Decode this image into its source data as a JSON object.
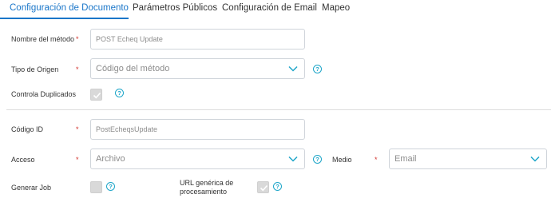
{
  "tabs": [
    {
      "label": "Configuración de Documento",
      "active": true
    },
    {
      "label": "Parámetros Públicos"
    },
    {
      "label": "Configuración de Email"
    },
    {
      "label": "Mapeo"
    }
  ],
  "form": {
    "nombre_metodo": {
      "label": "Nombre del método",
      "required": "*",
      "value": "POST Echeq Update"
    },
    "tipo_origen": {
      "label": "Tipo de Origen",
      "required": "*",
      "value": "Código del método"
    },
    "controla_duplicados": {
      "label": "Controla Duplicados",
      "checked": true
    },
    "codigo_id": {
      "label": "Código ID",
      "required": "*",
      "value": "PostEcheqsUpdate"
    },
    "acceso": {
      "label": "Acceso",
      "required": "*",
      "value": "Archivo"
    },
    "medio": {
      "label": "Medio",
      "required": "*",
      "value": "Email"
    },
    "generar_job": {
      "label": "Generar Job",
      "checked": false
    },
    "url_generica": {
      "label_line1": "URL genérica de",
      "label_line2": "procesamiento",
      "checked": true
    }
  },
  "help_icon_glyph": "?",
  "colors": {
    "accent": "#1a76c9",
    "help": "#1fa6c9",
    "required": "#d2332d"
  }
}
